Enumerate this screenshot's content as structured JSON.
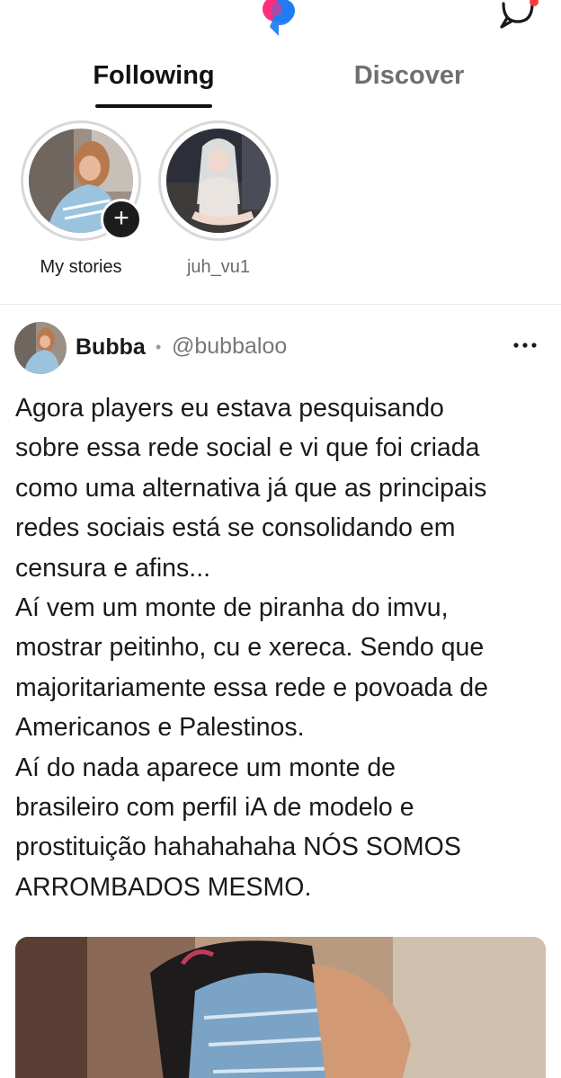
{
  "tabs": [
    {
      "label": "Following",
      "active": true
    },
    {
      "label": "Discover",
      "active": false
    }
  ],
  "stories": [
    {
      "label": "My stories",
      "has_add": true,
      "add_symbol": "+"
    },
    {
      "label": "juh_vu1",
      "has_add": false
    }
  ],
  "post": {
    "author_name": "Bubba",
    "separator": "•",
    "author_handle": "@bubbaloo",
    "more_label": "···",
    "text": "Agora players eu estava pesquisando\nsobre essa rede social e vi que foi criada\ncomo uma alternativa já que as principais\nredes sociais está se  consolidando em\ncensura e afins...\nAí vem um monte de piranha do imvu,\nmostrar peitinho, cu e xereca. Sendo que\nmajoritariamente essa rede e povoada de\nAmericanos e Palestinos.\nAí do nada aparece um monte de\nbrasileiro com perfil iA de modelo e\nprostituição hahahahaha  NÓS SOMOS\nARROMBADOS MESMO.",
    "has_image": true
  },
  "icons": {
    "logo": "app-logo-icon",
    "chat": "chat-bubble-icon",
    "more": "more-horizontal-icon"
  },
  "colors": {
    "logo_pink": "#ff2e7e",
    "logo_blue": "#1f7cf2",
    "tab_active": "#111111",
    "tab_inactive": "#6f6f6f",
    "handle_gray": "#777777"
  }
}
